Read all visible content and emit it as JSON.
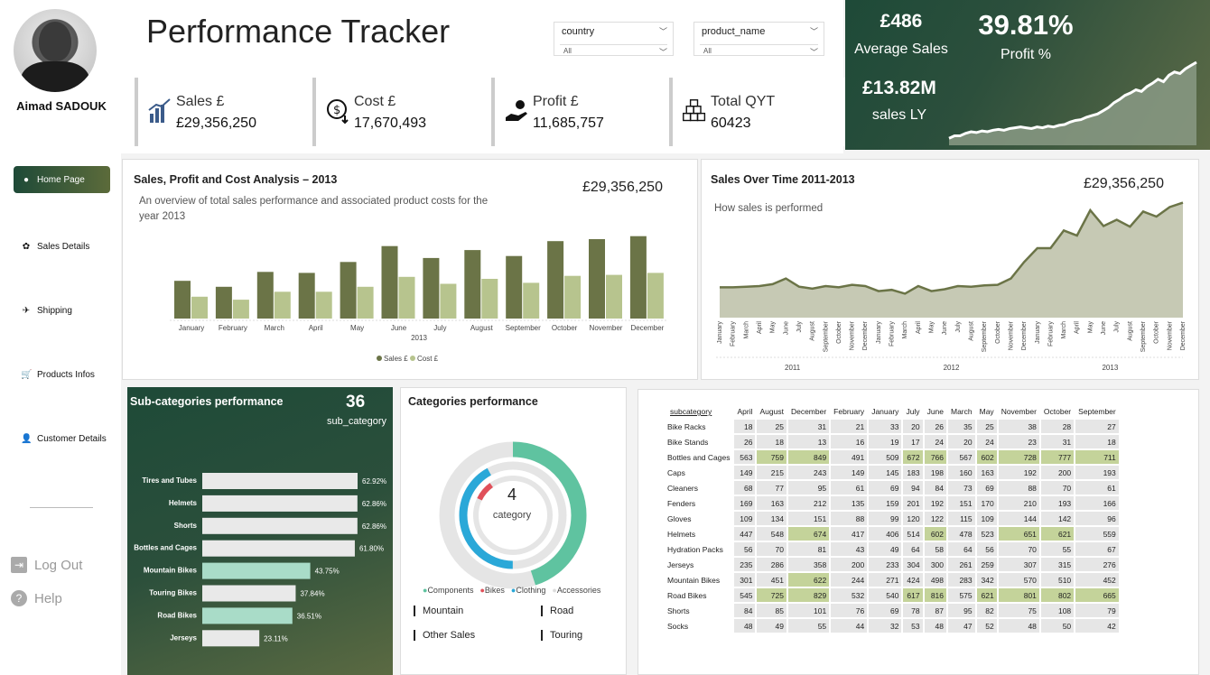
{
  "user": {
    "name": "Aimad SADOUK"
  },
  "nav": {
    "items": [
      {
        "label": "Home Page",
        "icon": "circle-icon"
      },
      {
        "label": "Sales Details",
        "icon": "tag-icon"
      },
      {
        "label": "Shipping",
        "icon": "plane-icon"
      },
      {
        "label": "Products Infos",
        "icon": "cart-icon"
      },
      {
        "label": "Customer Details",
        "icon": "person-icon"
      }
    ],
    "logout": "Log Out",
    "help": "Help"
  },
  "header": {
    "title": "Performance Tracker"
  },
  "slicers": [
    {
      "label": "country",
      "value": "All"
    },
    {
      "label": "product_name",
      "value": "All"
    }
  ],
  "kpis": [
    {
      "label": "Sales £",
      "value": "£29,356,250",
      "icon": "sales-chart-icon"
    },
    {
      "label": "Cost £",
      "value": "17,670,493",
      "icon": "cost-coin-icon"
    },
    {
      "label": "Profit £",
      "value": "11,685,757",
      "icon": "hand-money-icon"
    },
    {
      "label": "Total QYT",
      "value": "60423",
      "icon": "boxes-icon"
    }
  ],
  "hero": {
    "avg_sales": "£486",
    "avg_sales_label": "Average Sales",
    "profit_pct": "39.81%",
    "profit_label": "Profit %",
    "sales_ly": "£13.82M",
    "sales_ly_label": "sales LY",
    "spark": [
      2,
      5,
      5,
      8,
      10,
      9,
      11,
      10,
      12,
      13,
      12,
      14,
      15,
      16,
      15,
      14,
      16,
      15,
      17,
      16,
      18,
      19,
      22,
      24,
      25,
      28,
      30,
      32,
      36,
      40,
      46,
      50,
      55,
      58,
      62,
      60,
      66,
      70,
      75,
      72,
      80,
      84,
      82,
      88,
      92,
      96
    ]
  },
  "bar_chart": {
    "title": "Sales, Profit and Cost Analysis – 2013",
    "subtitle": "An overview of total sales performance and associated product costs for the year 2013",
    "total": "£29,356,250",
    "xaxis": "2013"
  },
  "line_chart": {
    "title": "Sales Over Time 2011-2013",
    "subtitle": "How sales is performed",
    "total": "£29,356,250",
    "years": [
      "2011",
      "2012",
      "2013"
    ]
  },
  "subcat": {
    "title": "Sub-categories performance",
    "count": "36",
    "count_label": "sub_category"
  },
  "categories": {
    "title": "Categories performance",
    "center_value": "4",
    "center_label": "category",
    "legend": [
      {
        "name": "Components",
        "color": "#5fc3a0"
      },
      {
        "name": "Bikes",
        "color": "#e0505a"
      },
      {
        "name": "Clothing",
        "color": "#2aa8d8"
      },
      {
        "name": "Accessories",
        "color": "#dddddd"
      }
    ],
    "slicer_items": [
      "Mountain",
      "Road",
      "Other Sales",
      "Touring"
    ]
  },
  "heatmap": {
    "corner": "subcategory",
    "columns": [
      "April",
      "August",
      "December",
      "February",
      "January",
      "July",
      "June",
      "March",
      "May",
      "November",
      "October",
      "September"
    ],
    "rows": [
      {
        "name": "Bike Racks",
        "v": [
          "18",
          "25",
          "31",
          "21",
          "33",
          "20",
          "26",
          "35",
          "25",
          "38",
          "28",
          "27"
        ]
      },
      {
        "name": "Bike Stands",
        "v": [
          "26",
          "18",
          "13",
          "16",
          "19",
          "17",
          "24",
          "20",
          "24",
          "23",
          "31",
          "18"
        ]
      },
      {
        "name": "Bottles and Cages",
        "v": [
          "563",
          "759",
          "849",
          "491",
          "509",
          "672",
          "766",
          "567",
          "602",
          "728",
          "777",
          "711"
        ]
      },
      {
        "name": "Caps",
        "v": [
          "149",
          "215",
          "243",
          "149",
          "145",
          "183",
          "198",
          "160",
          "163",
          "192",
          "200",
          "193"
        ]
      },
      {
        "name": "Cleaners",
        "v": [
          "68",
          "77",
          "95",
          "61",
          "69",
          "94",
          "84",
          "73",
          "69",
          "88",
          "70",
          "61"
        ]
      },
      {
        "name": "Fenders",
        "v": [
          "169",
          "163",
          "212",
          "135",
          "159",
          "201",
          "192",
          "151",
          "170",
          "210",
          "193",
          "166"
        ]
      },
      {
        "name": "Gloves",
        "v": [
          "109",
          "134",
          "151",
          "88",
          "99",
          "120",
          "122",
          "115",
          "109",
          "144",
          "142",
          "96"
        ]
      },
      {
        "name": "Helmets",
        "v": [
          "447",
          "548",
          "674",
          "417",
          "406",
          "514",
          "602",
          "478",
          "523",
          "651",
          "621",
          "559"
        ]
      },
      {
        "name": "Hydration Packs",
        "v": [
          "56",
          "70",
          "81",
          "43",
          "49",
          "64",
          "58",
          "64",
          "56",
          "70",
          "55",
          "67"
        ]
      },
      {
        "name": "Jerseys",
        "v": [
          "235",
          "286",
          "358",
          "200",
          "233",
          "304",
          "300",
          "261",
          "259",
          "307",
          "315",
          "276"
        ]
      },
      {
        "name": "Mountain Bikes",
        "v": [
          "301",
          "451",
          "622",
          "244",
          "271",
          "424",
          "498",
          "283",
          "342",
          "570",
          "510",
          "452"
        ]
      },
      {
        "name": "Road Bikes",
        "v": [
          "545",
          "725",
          "829",
          "532",
          "540",
          "617",
          "816",
          "575",
          "621",
          "801",
          "802",
          "665"
        ]
      },
      {
        "name": "Shorts",
        "v": [
          "84",
          "85",
          "101",
          "76",
          "69",
          "78",
          "87",
          "95",
          "82",
          "75",
          "108",
          "79"
        ]
      },
      {
        "name": "Socks",
        "v": [
          "48",
          "49",
          "55",
          "44",
          "32",
          "53",
          "48",
          "47",
          "52",
          "48",
          "50",
          "42"
        ]
      }
    ]
  },
  "colors": {
    "dark_green": "#1e4a38",
    "olive": "#6b7447",
    "light_olive": "#b7c48e",
    "mint": "#9fd9c4",
    "area": "#c6c9b4"
  },
  "chart_data": [
    {
      "type": "bar",
      "title": "Sales, Profit and Cost Analysis – 2013",
      "categories": [
        "January",
        "February",
        "March",
        "April",
        "May",
        "June",
        "July",
        "August",
        "September",
        "October",
        "November",
        "December"
      ],
      "series": [
        {
          "name": "Sales £",
          "values": [
            1.9,
            1.6,
            2.35,
            2.3,
            2.85,
            3.65,
            3.05,
            3.45,
            3.15,
            3.9,
            4.0,
            4.15
          ]
        },
        {
          "name": "Cost £",
          "values": [
            1.1,
            0.95,
            1.35,
            1.35,
            1.6,
            2.1,
            1.75,
            2.0,
            1.8,
            2.15,
            2.2,
            2.3
          ]
        }
      ],
      "legend": "bottom"
    },
    {
      "type": "area",
      "title": "Sales Over Time 2011-2013",
      "x": [
        "January",
        "February",
        "March",
        "April",
        "May",
        "June",
        "July",
        "August",
        "September",
        "October",
        "November",
        "December",
        "January",
        "February",
        "March",
        "April",
        "May",
        "June",
        "July",
        "August",
        "September",
        "October",
        "November",
        "December",
        "January",
        "February",
        "March",
        "April",
        "May",
        "June",
        "July",
        "August",
        "September",
        "October",
        "November",
        "December"
      ],
      "values": [
        0.48,
        0.48,
        0.49,
        0.5,
        0.53,
        0.62,
        0.49,
        0.46,
        0.5,
        0.48,
        0.52,
        0.5,
        0.42,
        0.44,
        0.38,
        0.5,
        0.42,
        0.45,
        0.5,
        0.49,
        0.51,
        0.52,
        0.62,
        0.88,
        1.1,
        1.1,
        1.38,
        1.3,
        1.7,
        1.45,
        1.55,
        1.44,
        1.68,
        1.6,
        1.75,
        1.82
      ]
    },
    {
      "type": "bar",
      "title": "Sub-categories performance",
      "categories": [
        "Tires and Tubes",
        "Helmets",
        "Shorts",
        "Bottles and Cages",
        "Mountain Bikes",
        "Touring Bikes",
        "Road Bikes",
        "Jerseys"
      ],
      "values": [
        62.92,
        62.86,
        62.86,
        61.8,
        43.75,
        37.84,
        36.51,
        23.11
      ],
      "labels": [
        "62.92%",
        "62.86%",
        "62.86%",
        "61.80%",
        "43.75%",
        "37.84%",
        "36.51%",
        "23.11%"
      ],
      "highlight": [
        "Mountain Bikes",
        "Road Bikes"
      ]
    },
    {
      "type": "pie",
      "title": "Categories performance",
      "categories": [
        "Components",
        "Bikes",
        "Clothing",
        "Accessories"
      ],
      "values": [
        0.45,
        0.08,
        0.42,
        0.9
      ]
    }
  ]
}
